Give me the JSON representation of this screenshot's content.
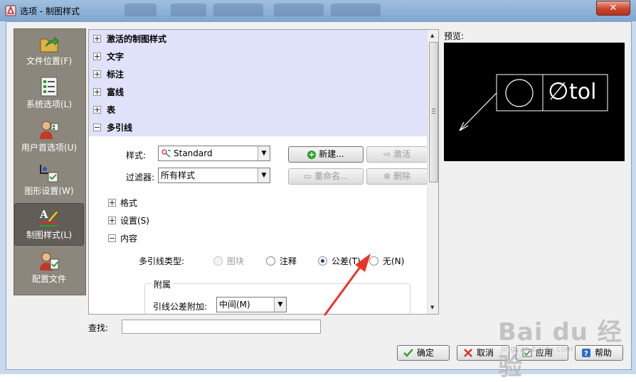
{
  "window": {
    "title": "选项 - 制图样式",
    "close_label": "✕"
  },
  "sidebar": {
    "items": [
      {
        "label": "文件位置(F)"
      },
      {
        "label": "系统选项(L)"
      },
      {
        "label": "用户首选项(U)"
      },
      {
        "label": "图形设置(W)"
      },
      {
        "label": "制图样式(L)",
        "active": true
      },
      {
        "label": "配置文件"
      }
    ]
  },
  "tree": {
    "sections": [
      "激活的制图样式",
      "文字",
      "标注",
      "富线",
      "表",
      "多引线"
    ]
  },
  "multileader": {
    "style_label": "样式:",
    "style_value": "Standard",
    "filter_label": "过滤器:",
    "filter_value": "所有样式",
    "buttons": {
      "new": "新建...",
      "activate": "激活",
      "rename": "重命名...",
      "delete": "删除"
    },
    "subsections": [
      "格式",
      "设置(S)",
      "内容"
    ],
    "type_label": "多引线类型:",
    "type_options": [
      {
        "label": "图块",
        "selected": false,
        "disabled": true
      },
      {
        "label": "注释",
        "selected": false,
        "disabled": false
      },
      {
        "label": "公差(T)",
        "selected": true,
        "disabled": false
      },
      {
        "label": "无(N)",
        "selected": false,
        "disabled": false
      }
    ],
    "attach_group": "附属",
    "attach_label": "引线公差附加:",
    "attach_value": "中间(M)"
  },
  "preview": {
    "label": "预览:",
    "tol_text": "tol",
    "diameter_symbol": "∅"
  },
  "search": {
    "label": "查找:",
    "value": ""
  },
  "footer": {
    "ok": "确定",
    "cancel": "取消",
    "apply": "应用",
    "help": "帮助"
  },
  "watermark": {
    "text": "Bai du 经验",
    "url": "jingyan.baidu.com"
  },
  "colors": {
    "highlight_rows": "#dfe2f9",
    "sidebar_bg": "#8c877c",
    "arrow_annotation": "#e8352b"
  }
}
